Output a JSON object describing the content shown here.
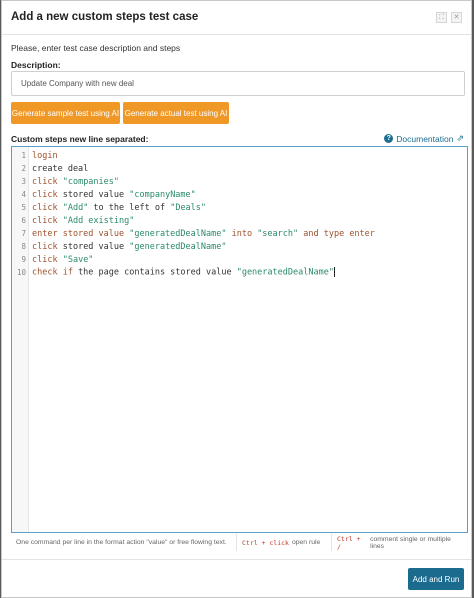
{
  "dialog": {
    "title": "Add a new custom steps test case",
    "intro": "Please, enter test case description and steps",
    "description_label": "Description:",
    "description_value": "Update Company with new deal",
    "generate_sample_label": "Generate sample test using AI",
    "generate_actual_label": "Generate actual test using AI",
    "steps_label": "Custom steps new line separated:",
    "documentation_label": "Documentation",
    "run_label": "Add and Run"
  },
  "editor": {
    "lines": [
      {
        "n": "1",
        "tokens": [
          {
            "t": "kw",
            "v": "login"
          }
        ]
      },
      {
        "n": "2",
        "tokens": [
          {
            "t": "plain",
            "v": "create deal"
          }
        ]
      },
      {
        "n": "3",
        "tokens": [
          {
            "t": "kw",
            "v": "click "
          },
          {
            "t": "str",
            "v": "\"companies\""
          }
        ]
      },
      {
        "n": "4",
        "tokens": [
          {
            "t": "kw",
            "v": "click "
          },
          {
            "t": "plain",
            "v": "stored value "
          },
          {
            "t": "str",
            "v": "\"companyName\""
          }
        ]
      },
      {
        "n": "5",
        "tokens": [
          {
            "t": "kw",
            "v": "click "
          },
          {
            "t": "str",
            "v": "\"Add\""
          },
          {
            "t": "plain",
            "v": " to the left of "
          },
          {
            "t": "str",
            "v": "\"Deals\""
          }
        ]
      },
      {
        "n": "6",
        "tokens": [
          {
            "t": "kw",
            "v": "click "
          },
          {
            "t": "str",
            "v": "\"Add existing\""
          }
        ]
      },
      {
        "n": "7",
        "tokens": [
          {
            "t": "kw",
            "v": "enter stored value "
          },
          {
            "t": "str",
            "v": "\"generatedDealName\""
          },
          {
            "t": "kw",
            "v": " into "
          },
          {
            "t": "str",
            "v": "\"search\""
          },
          {
            "t": "kw",
            "v": " and type enter"
          }
        ]
      },
      {
        "n": "8",
        "tokens": [
          {
            "t": "kw",
            "v": "click "
          },
          {
            "t": "plain",
            "v": "stored value "
          },
          {
            "t": "str",
            "v": "\"generatedDealName\""
          }
        ]
      },
      {
        "n": "9",
        "tokens": [
          {
            "t": "kw",
            "v": "click "
          },
          {
            "t": "str",
            "v": "\"Save\""
          }
        ]
      },
      {
        "n": "10",
        "tokens": [
          {
            "t": "kw",
            "v": "check if "
          },
          {
            "t": "plain",
            "v": "the page contains stored value "
          },
          {
            "t": "str",
            "v": "\"generatedDealName\""
          }
        ]
      }
    ]
  },
  "hints": {
    "h1": "One command per line in the format action \"value\" or free flowing text.",
    "h2_key": "Ctrl + click",
    "h2_text": "open rule",
    "h3_key": "Ctrl + /",
    "h3_text": "comment single or multiple lines"
  },
  "icons": {
    "maximize": "maximize-icon",
    "close": "close-icon",
    "help": "question-circle-icon",
    "external": "external-link-icon"
  },
  "colors": {
    "accent_orange": "#ef9826",
    "primary_blue": "#1b6b8f",
    "link_blue": "#1a6e91",
    "keyword": "#a0522d",
    "string": "#2a8a6a"
  }
}
